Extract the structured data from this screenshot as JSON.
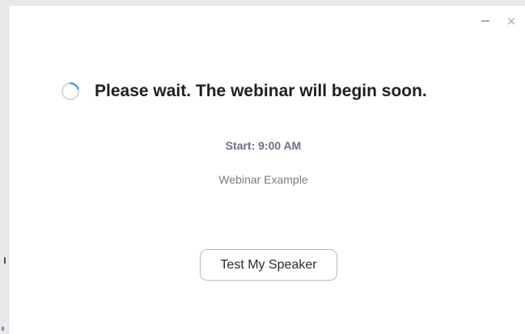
{
  "window": {
    "minimize_label": "–",
    "close_label": "×"
  },
  "main": {
    "headline": "Please wait. The webinar will begin soon.",
    "start_time": "Start: 9:00 AM",
    "webinar_name": "Webinar Example",
    "test_speaker_label": "Test My Speaker"
  },
  "icons": {
    "spinner": "loading-spinner-icon",
    "minimize": "minimize-icon",
    "close": "close-icon"
  },
  "colors": {
    "spinner_track": "#d6d6dc",
    "spinner_arc": "#2d8cff",
    "headline": "#1f1f24",
    "muted_text": "#7a7a85"
  }
}
